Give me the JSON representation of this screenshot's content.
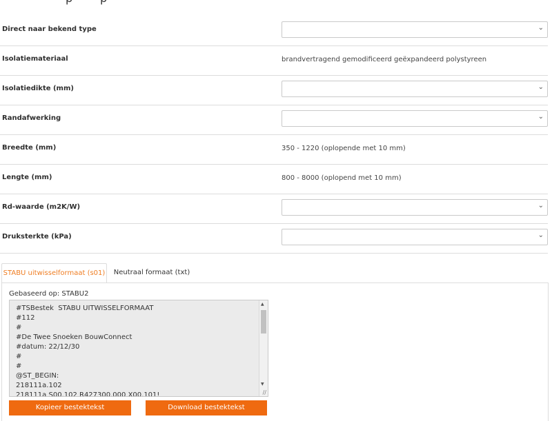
{
  "rows": [
    {
      "label": "Direct naar bekend type",
      "kind": "select",
      "value": ""
    },
    {
      "label": "Isolatiemateriaal",
      "kind": "text",
      "value": "brandvertragend gemodificeerd geëxpandeerd polystyreen"
    },
    {
      "label": "Isolatiedikte (mm)",
      "kind": "select",
      "value": ""
    },
    {
      "label": "Randafwerking",
      "kind": "select",
      "value": ""
    },
    {
      "label": "Breedte (mm)",
      "kind": "text",
      "value": "350 - 1220 (oplopende met 10 mm)"
    },
    {
      "label": "Lengte (mm)",
      "kind": "text",
      "value": "800 - 8000 (oplopend met 10 mm)"
    },
    {
      "label": "Rd-waarde (m2K/W)",
      "kind": "select",
      "value": ""
    },
    {
      "label": "Druksterkte (kPa)",
      "kind": "select",
      "value": ""
    }
  ],
  "tabs": {
    "active": "STABU uitwisselformaat (s01)",
    "inactive": "Neutraal formaat (txt)"
  },
  "panel": {
    "based_on": "Gebaseerd op: STABU2",
    "lines": [
      "#TSBestek  STABU UITWISSELFORMAAT",
      "#112",
      "#",
      "#De Twee Snoeken BouwConnect",
      "#datum: 22/12/30",
      "#",
      "#",
      "@ST_BEGIN:",
      "218111a.102",
      "218111a S00.102 R427300.000 X00.101!"
    ]
  },
  "buttons": {
    "copy": "Kopieer bestektekst",
    "download": "Download bestektekst"
  },
  "colors": {
    "accent": "#ef6a10",
    "tab_active_text": "#ef7d22",
    "textarea_bg": "#ebebeb"
  }
}
